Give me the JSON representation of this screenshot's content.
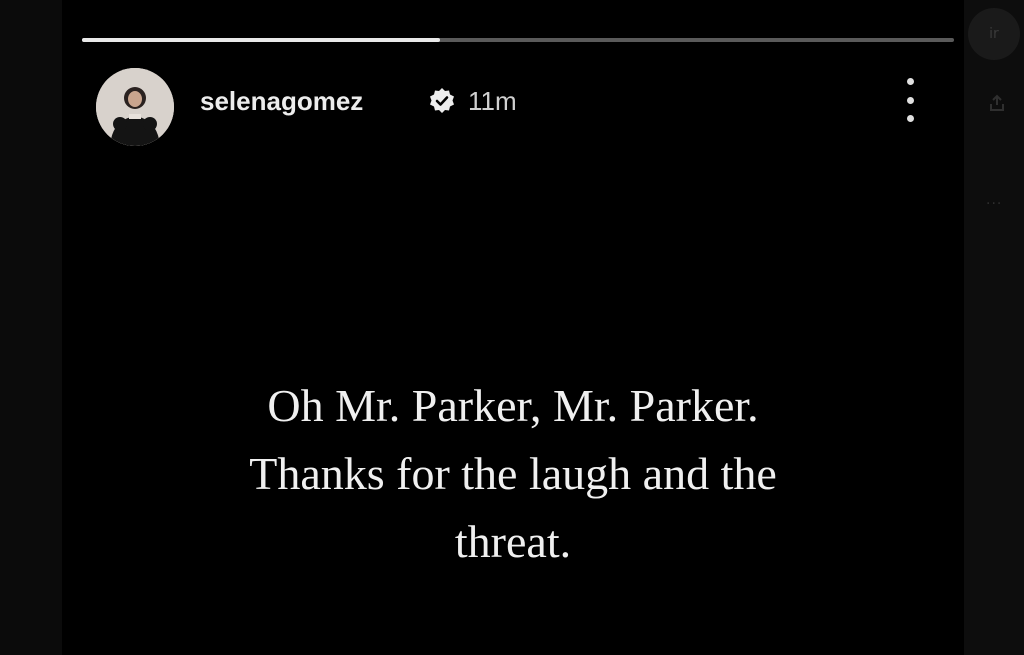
{
  "story": {
    "username": "selenagomez",
    "timestamp": "11m",
    "progress": 0.41,
    "caption_lines": [
      "Oh Mr. Parker, Mr. Parker.",
      "Thanks for the laugh and the",
      "threat."
    ]
  },
  "right_rail": {
    "button_text": "ir",
    "more_text": "···"
  },
  "icons": {
    "verified": "verified-badge-icon",
    "menu": "more-vertical-icon",
    "share": "share-icon"
  },
  "colors": {
    "background": "#000000",
    "text": "#f0f0f0",
    "progress_fill": "#e8e8e8",
    "progress_track": "#5a5a5a"
  }
}
